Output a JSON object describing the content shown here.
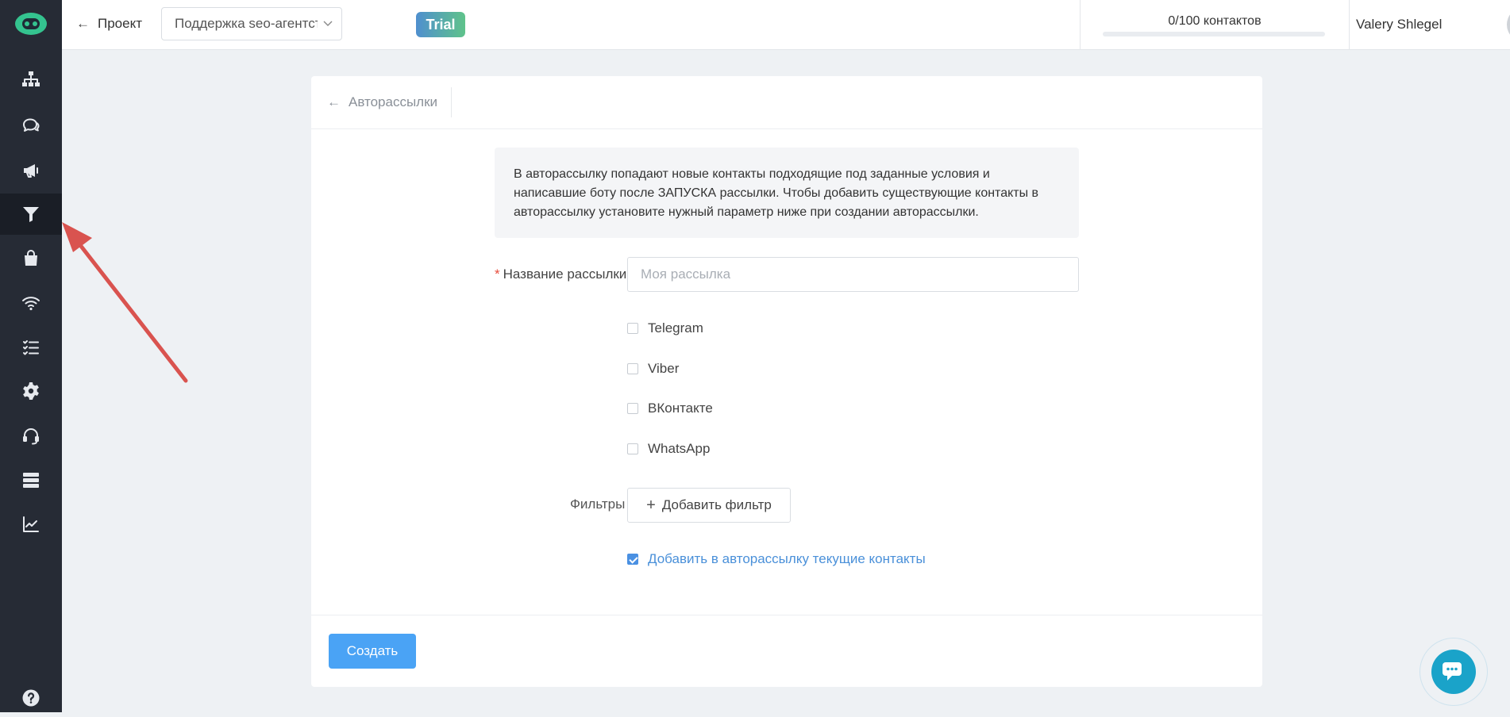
{
  "header": {
    "back_label": "Проект",
    "project_value": "Поддержка seo-агентства",
    "trial_label": "Trial",
    "contacts_text": "0/100 контактов",
    "contacts_progress_percent": 0,
    "user_name": "Valery Shlegel"
  },
  "card": {
    "back_label": "Авторассылки",
    "info_text": "В авторассылку попадают новые контакты подходящие под заданные условия и написавшие боту после ЗАПУСКА рассылки. Чтобы добавить существующие контакты в авторассылку установите нужный параметр ниже при создании авторассылки.",
    "name_label": "Название рассылки",
    "name_required_mark": "*",
    "name_placeholder": "Моя рассылка",
    "channels": [
      {
        "label": "Telegram",
        "checked": false
      },
      {
        "label": "Viber",
        "checked": false
      },
      {
        "label": "ВКонтакте",
        "checked": false
      },
      {
        "label": "WhatsApp",
        "checked": false
      }
    ],
    "filters_label": "Фильтры",
    "add_filter_label": "Добавить фильтр",
    "add_existing_label": "Добавить в авторассылку текущие контакты",
    "add_existing_checked": true,
    "create_label": "Создать"
  },
  "colors": {
    "sidebar_bg": "#262b35",
    "accent": "#4aa3f5",
    "link": "#4a90d9",
    "annotation": "#d9534f",
    "chat": "#1aa3c9"
  },
  "icons": {
    "sidebar": [
      "sitemap-icon",
      "chat-bubbles-icon",
      "megaphone-icon",
      "funnel-icon",
      "shopping-bag-icon",
      "wifi-icon",
      "checklist-icon",
      "gear-icon",
      "headset-icon",
      "server-icon",
      "chart-line-icon",
      "help-icon"
    ]
  }
}
